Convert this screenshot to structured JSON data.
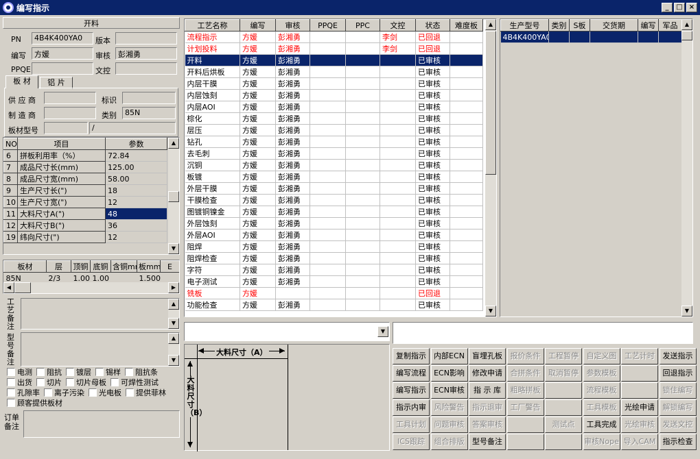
{
  "window": {
    "title": "编写指示",
    "min": "_",
    "max": "□",
    "close": "×"
  },
  "left": {
    "header": "开料",
    "labels": {
      "pn": "PN",
      "version": "版本",
      "writer": "编写",
      "auditor": "审核",
      "ppqe": "PPQE",
      "wenkong": "文控"
    },
    "values": {
      "pn": "4B4K400YA0",
      "version": "",
      "writer": "方媛",
      "auditor": "彭湘勇",
      "ppqe": "",
      "wenkong": ""
    },
    "tabs": [
      "板 材",
      "铝 片"
    ],
    "material": {
      "labels": {
        "supplier": "供 应 商",
        "mark": "标识",
        "maker": "制 造 商",
        "category": "类别",
        "model": "板材型号"
      },
      "values": {
        "supplier": "",
        "mark": "",
        "maker": "",
        "category": "85N",
        "model": "",
        "model2": "/"
      }
    },
    "params": {
      "headers": [
        "NO",
        "项目",
        "参数"
      ],
      "rows": [
        {
          "no": "6",
          "item": "拼板利用率（%）",
          "val": "72.84"
        },
        {
          "no": "7",
          "item": "成品尺寸长(mm)",
          "val": "125.00"
        },
        {
          "no": "8",
          "item": "成品尺寸宽(mm)",
          "val": "58.00"
        },
        {
          "no": "9",
          "item": "生产尺寸长(\")",
          "val": "18"
        },
        {
          "no": "10",
          "item": "生产尺寸宽(\")",
          "val": "12"
        },
        {
          "no": "11",
          "item": "大料尺寸A(\")",
          "val": "48"
        },
        {
          "no": "12",
          "item": "大料尺寸B(\")",
          "val": "36"
        },
        {
          "no": "19",
          "item": "纬向尺寸(\")",
          "val": "12"
        }
      ]
    },
    "layers": {
      "headers": [
        "板材",
        "层",
        "顶铜",
        "底铜",
        "含铜mm",
        "板mm",
        "E"
      ],
      "rows": [
        {
          "c": [
            "85N",
            "2/3",
            "1.00",
            "1.00",
            "",
            "1.500",
            ""
          ]
        }
      ]
    },
    "notes": {
      "process": "工艺备注",
      "model": "型号备注",
      "order": "订单备注"
    },
    "checkboxes": [
      [
        "电测",
        "阻抗",
        "镀层",
        "锡样",
        "阻抗条"
      ],
      [
        "出货",
        "切片",
        "切片母板",
        "可焊性测试"
      ],
      [
        "孔隙率",
        "离子污染",
        "光电板",
        "提供菲林"
      ],
      [
        "顾客提供板材"
      ]
    ]
  },
  "process": {
    "headers": [
      "工艺名称",
      "编写",
      "审核",
      "PPQE",
      "PPC",
      "文控",
      "状态",
      "难度板"
    ],
    "rows": [
      {
        "name": "流程指示",
        "writer": "方媛",
        "auditor": "彭湘勇",
        "ppqe": "",
        "ppc": "",
        "wk": "李剑",
        "status": "已回退",
        "diff": "",
        "red": true
      },
      {
        "name": "计划投料",
        "writer": "方媛",
        "auditor": "彭湘勇",
        "ppqe": "",
        "ppc": "",
        "wk": "李剑",
        "status": "已回退",
        "diff": "",
        "red": true
      },
      {
        "name": "开料",
        "writer": "方媛",
        "auditor": "彭湘勇",
        "ppqe": "",
        "ppc": "",
        "wk": "",
        "status": "已审核",
        "diff": "",
        "sel": true
      },
      {
        "name": "开料后烘板",
        "writer": "方媛",
        "auditor": "彭湘勇",
        "ppqe": "",
        "ppc": "",
        "wk": "",
        "status": "已审核",
        "diff": ""
      },
      {
        "name": "内层干膜",
        "writer": "方媛",
        "auditor": "彭湘勇",
        "ppqe": "",
        "ppc": "",
        "wk": "",
        "status": "已审核",
        "diff": ""
      },
      {
        "name": "内层蚀刻",
        "writer": "方媛",
        "auditor": "彭湘勇",
        "ppqe": "",
        "ppc": "",
        "wk": "",
        "status": "已审核",
        "diff": ""
      },
      {
        "name": "内层AOI",
        "writer": "方媛",
        "auditor": "彭湘勇",
        "ppqe": "",
        "ppc": "",
        "wk": "",
        "status": "已审核",
        "diff": ""
      },
      {
        "name": "棕化",
        "writer": "方媛",
        "auditor": "彭湘勇",
        "ppqe": "",
        "ppc": "",
        "wk": "",
        "status": "已审核",
        "diff": ""
      },
      {
        "name": "层压",
        "writer": "方媛",
        "auditor": "彭湘勇",
        "ppqe": "",
        "ppc": "",
        "wk": "",
        "status": "已审核",
        "diff": ""
      },
      {
        "name": "钻孔",
        "writer": "方媛",
        "auditor": "彭湘勇",
        "ppqe": "",
        "ppc": "",
        "wk": "",
        "status": "已审核",
        "diff": ""
      },
      {
        "name": "去毛刺",
        "writer": "方媛",
        "auditor": "彭湘勇",
        "ppqe": "",
        "ppc": "",
        "wk": "",
        "status": "已审核",
        "diff": ""
      },
      {
        "name": "沉铜",
        "writer": "方媛",
        "auditor": "彭湘勇",
        "ppqe": "",
        "ppc": "",
        "wk": "",
        "status": "已审核",
        "diff": ""
      },
      {
        "name": "板镀",
        "writer": "方媛",
        "auditor": "彭湘勇",
        "ppqe": "",
        "ppc": "",
        "wk": "",
        "status": "已审核",
        "diff": ""
      },
      {
        "name": "外层干膜",
        "writer": "方媛",
        "auditor": "彭湘勇",
        "ppqe": "",
        "ppc": "",
        "wk": "",
        "status": "已审核",
        "diff": ""
      },
      {
        "name": "干膜检查",
        "writer": "方媛",
        "auditor": "彭湘勇",
        "ppqe": "",
        "ppc": "",
        "wk": "",
        "status": "已审核",
        "diff": ""
      },
      {
        "name": "图镀铜镍金",
        "writer": "方媛",
        "auditor": "彭湘勇",
        "ppqe": "",
        "ppc": "",
        "wk": "",
        "status": "已审核",
        "diff": ""
      },
      {
        "name": "外层蚀刻",
        "writer": "方媛",
        "auditor": "彭湘勇",
        "ppqe": "",
        "ppc": "",
        "wk": "",
        "status": "已审核",
        "diff": ""
      },
      {
        "name": "外层AOI",
        "writer": "方媛",
        "auditor": "彭湘勇",
        "ppqe": "",
        "ppc": "",
        "wk": "",
        "status": "已审核",
        "diff": ""
      },
      {
        "name": "阻焊",
        "writer": "方媛",
        "auditor": "彭湘勇",
        "ppqe": "",
        "ppc": "",
        "wk": "",
        "status": "已审核",
        "diff": ""
      },
      {
        "name": "阻焊检查",
        "writer": "方媛",
        "auditor": "彭湘勇",
        "ppqe": "",
        "ppc": "",
        "wk": "",
        "status": "已审核",
        "diff": ""
      },
      {
        "name": "字符",
        "writer": "方媛",
        "auditor": "彭湘勇",
        "ppqe": "",
        "ppc": "",
        "wk": "",
        "status": "已审核",
        "diff": ""
      },
      {
        "name": "电子测试",
        "writer": "方媛",
        "auditor": "彭湘勇",
        "ppqe": "",
        "ppc": "",
        "wk": "",
        "status": "已审核",
        "diff": ""
      },
      {
        "name": "铣板",
        "writer": "方媛",
        "auditor": "",
        "ppqe": "",
        "ppc": "",
        "wk": "",
        "status": "已回退",
        "diff": "",
        "red": true
      },
      {
        "name": "功能检查",
        "writer": "方媛",
        "auditor": "彭湘勇",
        "ppqe": "",
        "ppc": "",
        "wk": "",
        "status": "已审核",
        "diff": ""
      }
    ]
  },
  "models": {
    "headers": [
      "生产型号",
      "类别",
      "S板",
      "交货期",
      "编写",
      "军品"
    ],
    "rows": [
      {
        "c": [
          "4B4K400YA0",
          "",
          "",
          "",
          "",
          ""
        ]
      }
    ]
  },
  "diagram": {
    "a_label": "大料尺寸（A）",
    "b_label": "大料尺寸（B）"
  },
  "buttons": [
    [
      "复制指示",
      "内部ECN",
      "盲埋孔板",
      "报价条件",
      "工程暂停",
      "自定义图",
      "工艺计时",
      "发送指示"
    ],
    [
      "编写流程",
      "ECN影响",
      "修改申请",
      "合拼条件",
      "取消暂停",
      "参数模板",
      "",
      "回退指示"
    ],
    [
      "编写指示",
      "ECN审核",
      "指 示 库",
      "粗略拼板",
      "",
      "流程模板",
      "",
      "锁住编写"
    ],
    [
      "指示内审",
      "风险警告",
      "指示退审",
      "工厂警告",
      "",
      "工具模板",
      "光绘申请",
      "解锁编写"
    ],
    [
      "工具计划",
      "问题审核",
      "答案审核",
      "",
      "测试点",
      "工具完成",
      "光绘审核",
      "发送文控"
    ],
    [
      "ICS跟踪",
      "组合排版",
      "型号备注",
      "",
      "",
      "审核Nope",
      "导入CAM",
      "指示检查"
    ]
  ],
  "buttons_disabled": [
    [
      false,
      false,
      false,
      true,
      true,
      true,
      true,
      false
    ],
    [
      false,
      false,
      false,
      true,
      true,
      true,
      true,
      false
    ],
    [
      false,
      false,
      false,
      true,
      true,
      true,
      true,
      true
    ],
    [
      false,
      true,
      true,
      true,
      true,
      true,
      false,
      true
    ],
    [
      true,
      true,
      true,
      true,
      true,
      false,
      true,
      true
    ],
    [
      true,
      true,
      false,
      true,
      true,
      true,
      true,
      false
    ]
  ]
}
